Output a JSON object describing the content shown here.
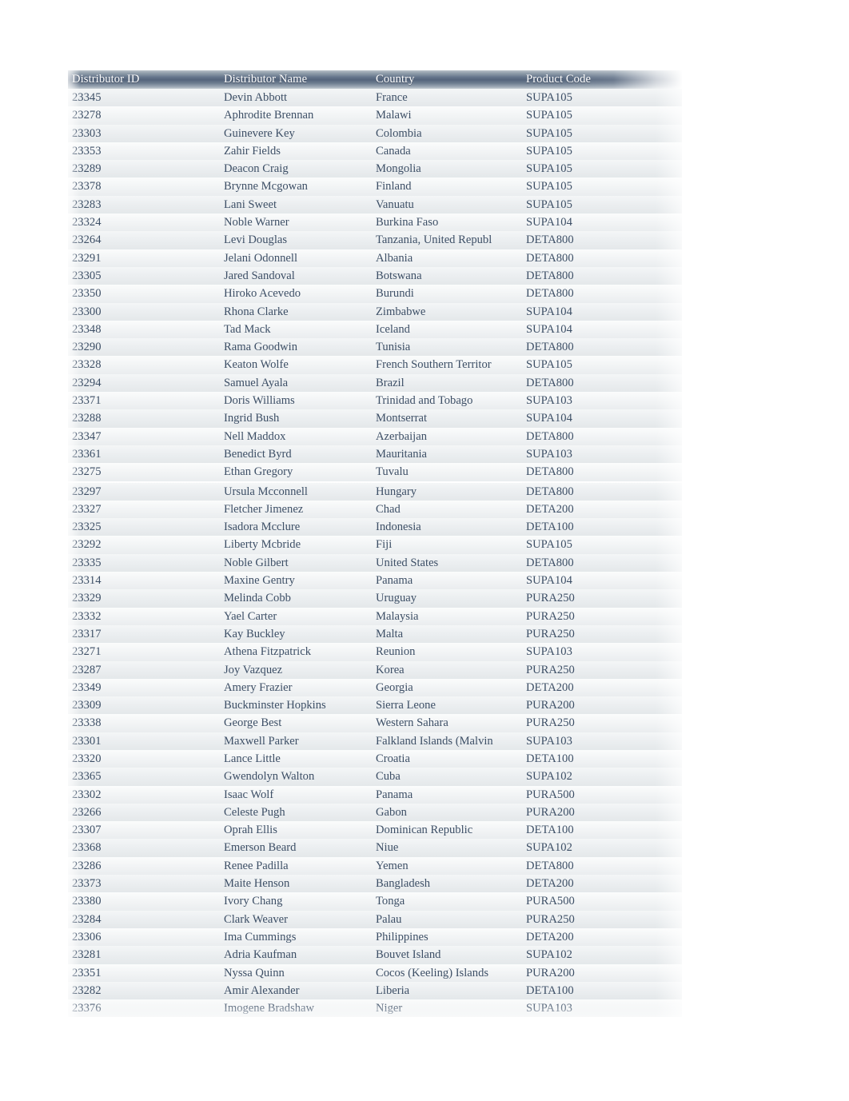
{
  "table": {
    "name": "distributor-table",
    "columns": [
      {
        "key": "id",
        "label": "Distributor ID"
      },
      {
        "key": "name",
        "label": "Distributor Name"
      },
      {
        "key": "country",
        "label": "Country"
      },
      {
        "key": "code",
        "label": "Product Code"
      }
    ],
    "colors": {
      "header_gradient_top": "#b9c1c9",
      "header_gradient_mid": "#55657c",
      "header_gradient_bottom": "#c3cad1",
      "header_text": "#ffffff",
      "body_text": "#3d4f66",
      "row_band_a": "#eceff1",
      "row_band_b": "#f3f5f6",
      "page_background": "#ffffff"
    },
    "row_count": 51,
    "rows": [
      {
        "id": "23345",
        "name": "Devin Abbott",
        "country": "France",
        "code": "SUPA105"
      },
      {
        "id": "23278",
        "name": "Aphrodite Brennan",
        "country": "Malawi",
        "code": "SUPA105"
      },
      {
        "id": "23303",
        "name": "Guinevere Key",
        "country": "Colombia",
        "code": "SUPA105"
      },
      {
        "id": "23353",
        "name": "Zahir Fields",
        "country": "Canada",
        "code": "SUPA105"
      },
      {
        "id": "23289",
        "name": "Deacon Craig",
        "country": "Mongolia",
        "code": "SUPA105"
      },
      {
        "id": "23378",
        "name": "Brynne Mcgowan",
        "country": "Finland",
        "code": "SUPA105"
      },
      {
        "id": "23283",
        "name": "Lani Sweet",
        "country": "Vanuatu",
        "code": "SUPA105"
      },
      {
        "id": "23324",
        "name": "Noble Warner",
        "country": "Burkina Faso",
        "code": "SUPA104"
      },
      {
        "id": "23264",
        "name": "Levi Douglas",
        "country": "Tanzania, United Republ",
        "code": "DETA800"
      },
      {
        "id": "23291",
        "name": "Jelani Odonnell",
        "country": "Albania",
        "code": "DETA800"
      },
      {
        "id": "23305",
        "name": "Jared Sandoval",
        "country": "Botswana",
        "code": "DETA800"
      },
      {
        "id": "23350",
        "name": "Hiroko Acevedo",
        "country": "Burundi",
        "code": "DETA800"
      },
      {
        "id": "23300",
        "name": "Rhona Clarke",
        "country": "Zimbabwe",
        "code": "SUPA104"
      },
      {
        "id": "23348",
        "name": "Tad Mack",
        "country": "Iceland",
        "code": "SUPA104"
      },
      {
        "id": "23290",
        "name": "Rama Goodwin",
        "country": "Tunisia",
        "code": "DETA800"
      },
      {
        "id": "23328",
        "name": "Keaton Wolfe",
        "country": "French Southern Territor",
        "code": "SUPA105"
      },
      {
        "id": "23294",
        "name": "Samuel Ayala",
        "country": "Brazil",
        "code": "DETA800"
      },
      {
        "id": "23371",
        "name": "Doris Williams",
        "country": "Trinidad and Tobago",
        "code": "SUPA103"
      },
      {
        "id": "23288",
        "name": "Ingrid Bush",
        "country": "Montserrat",
        "code": "SUPA104"
      },
      {
        "id": "23347",
        "name": "Nell Maddox",
        "country": "Azerbaijan",
        "code": "DETA800"
      },
      {
        "id": "23361",
        "name": "Benedict Byrd",
        "country": "Mauritania",
        "code": "SUPA103"
      },
      {
        "id": "23275",
        "name": "Ethan Gregory",
        "country": "Tuvalu",
        "code": "DETA800"
      },
      {
        "id": "23297",
        "name": "Ursula Mcconnell",
        "country": "Hungary",
        "code": "DETA800"
      },
      {
        "id": "23327",
        "name": "Fletcher Jimenez",
        "country": "Chad",
        "code": "DETA200"
      },
      {
        "id": "23325",
        "name": "Isadora Mcclure",
        "country": "Indonesia",
        "code": "DETA100"
      },
      {
        "id": "23292",
        "name": "Liberty Mcbride",
        "country": "Fiji",
        "code": "SUPA105"
      },
      {
        "id": "23335",
        "name": "Noble Gilbert",
        "country": "United States",
        "code": "DETA800"
      },
      {
        "id": "23314",
        "name": "Maxine Gentry",
        "country": "Panama",
        "code": "SUPA104"
      },
      {
        "id": "23329",
        "name": "Melinda Cobb",
        "country": "Uruguay",
        "code": "PURA250"
      },
      {
        "id": "23332",
        "name": "Yael Carter",
        "country": "Malaysia",
        "code": "PURA250"
      },
      {
        "id": "23317",
        "name": "Kay Buckley",
        "country": "Malta",
        "code": "PURA250"
      },
      {
        "id": "23271",
        "name": "Athena Fitzpatrick",
        "country": "Reunion",
        "code": "SUPA103"
      },
      {
        "id": "23287",
        "name": "Joy Vazquez",
        "country": "Korea",
        "code": "PURA250"
      },
      {
        "id": "23349",
        "name": "Amery Frazier",
        "country": "Georgia",
        "code": "DETA200"
      },
      {
        "id": "23309",
        "name": "Buckminster Hopkins",
        "country": "Sierra Leone",
        "code": "PURA200"
      },
      {
        "id": "23338",
        "name": "George Best",
        "country": "Western Sahara",
        "code": "PURA250"
      },
      {
        "id": "23301",
        "name": "Maxwell Parker",
        "country": "Falkland Islands (Malvin",
        "code": "SUPA103"
      },
      {
        "id": "23320",
        "name": "Lance Little",
        "country": "Croatia",
        "code": "DETA100"
      },
      {
        "id": "23365",
        "name": "Gwendolyn Walton",
        "country": "Cuba",
        "code": "SUPA102"
      },
      {
        "id": "23302",
        "name": "Isaac Wolf",
        "country": "Panama",
        "code": "PURA500"
      },
      {
        "id": "23266",
        "name": "Celeste Pugh",
        "country": "Gabon",
        "code": "PURA200"
      },
      {
        "id": "23307",
        "name": "Oprah Ellis",
        "country": "Dominican Republic",
        "code": "DETA100"
      },
      {
        "id": "23368",
        "name": "Emerson Beard",
        "country": "Niue",
        "code": "SUPA102"
      },
      {
        "id": "23286",
        "name": "Renee Padilla",
        "country": "Yemen",
        "code": "DETA800"
      },
      {
        "id": "23373",
        "name": "Maite Henson",
        "country": "Bangladesh",
        "code": "DETA200"
      },
      {
        "id": "23380",
        "name": "Ivory Chang",
        "country": "Tonga",
        "code": "PURA500"
      },
      {
        "id": "23284",
        "name": "Clark Weaver",
        "country": "Palau",
        "code": "PURA250"
      },
      {
        "id": "23306",
        "name": "Ima Cummings",
        "country": "Philippines",
        "code": "DETA200"
      },
      {
        "id": "23281",
        "name": "Adria Kaufman",
        "country": "Bouvet Island",
        "code": "SUPA102"
      },
      {
        "id": "23351",
        "name": "Nyssa Quinn",
        "country": "Cocos (Keeling) Islands",
        "code": "PURA200"
      },
      {
        "id": "23282",
        "name": "Amir Alexander",
        "country": "Liberia",
        "code": "DETA100"
      },
      {
        "id": "23376",
        "name": "Imogene Bradshaw",
        "country": "Niger",
        "code": "SUPA103"
      }
    ]
  }
}
